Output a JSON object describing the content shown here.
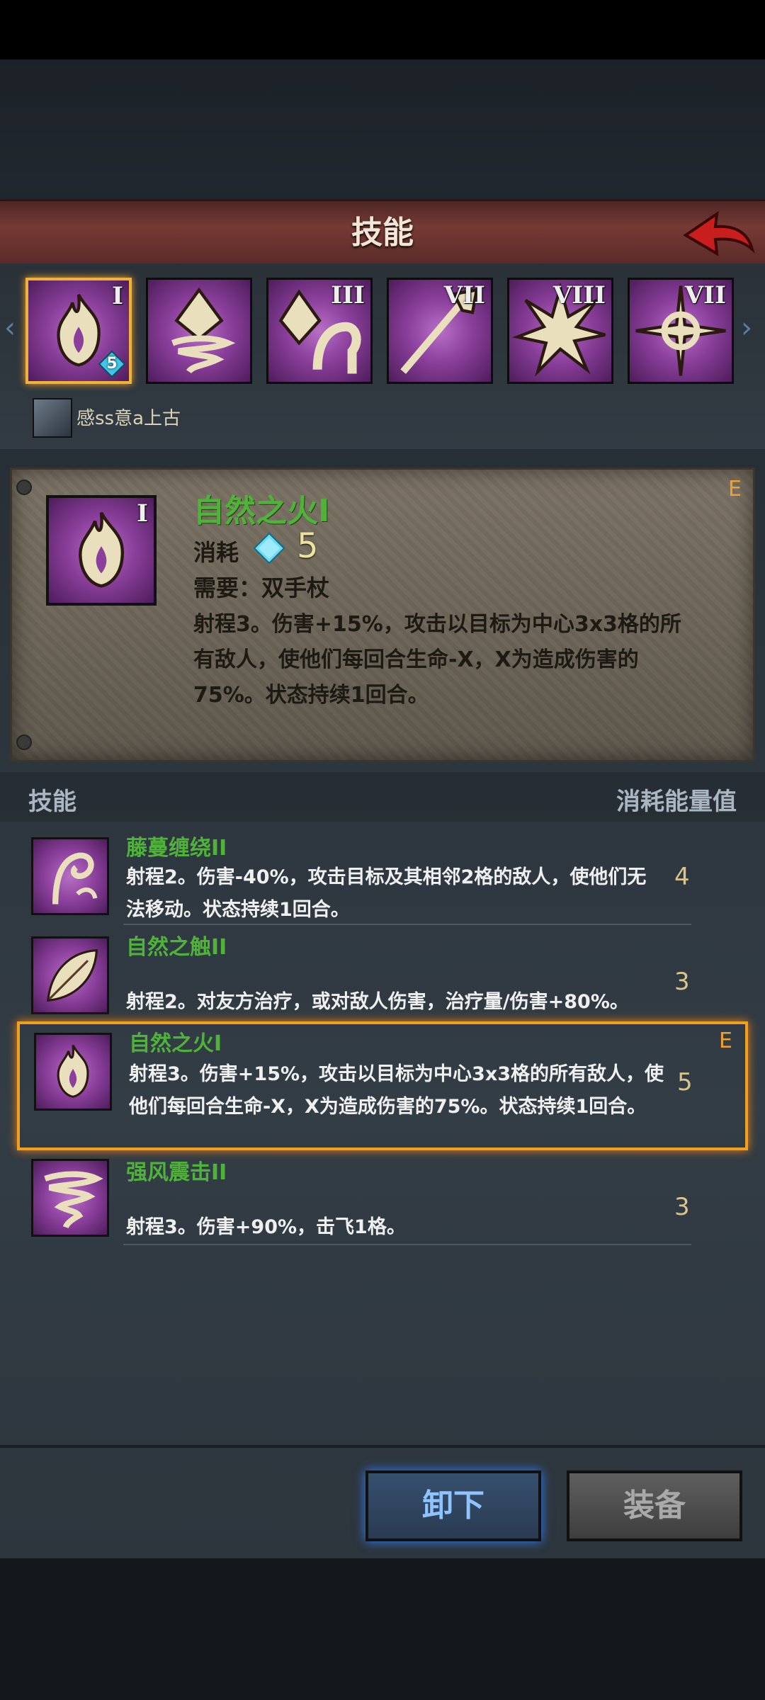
{
  "header": {
    "title": "技能"
  },
  "slots": [
    {
      "roman": "I",
      "icon": "flame-icon",
      "gem_value": "5",
      "selected": true
    },
    {
      "roman": "",
      "icon": "crystal-tornado-icon"
    },
    {
      "roman": "III",
      "icon": "crystal-vine-icon"
    },
    {
      "roman": "VII",
      "icon": "staff-icon"
    },
    {
      "roman": "VIII",
      "icon": "burst-icon"
    },
    {
      "roman": "VII",
      "icon": "holy-star-icon"
    }
  ],
  "user": {
    "name": "感ss意a上古"
  },
  "detail": {
    "name": "自然之火I",
    "roman": "I",
    "cost_label": "消耗",
    "cost_value": "5",
    "requirement": "需要：双手杖",
    "description": "射程3。伤害+15%，攻击以目标为中心3x3格的所有敌人，使他们每回合生命-X，X为造成伤害的75%。状态持续1回合。",
    "grade": "E"
  },
  "list_header": {
    "left": "技能",
    "right": "消耗能量值"
  },
  "skills": [
    {
      "name": "藤蔓缠绕II",
      "desc": "射程2。伤害-40%，攻击目标及其相邻2格的敌人，使他们无法移动。状态持续1回合。",
      "cost": "4",
      "icon": "vine-icon"
    },
    {
      "name": "自然之触II",
      "desc": "射程2。对友方治疗，或对敌人伤害，治疗量/伤害+80%。",
      "cost": "3",
      "icon": "leaf-icon"
    },
    {
      "name": "自然之火I",
      "desc": "射程3。伤害+15%，攻击以目标为中心3x3格的所有敌人，使他们每回合生命-X，X为造成伤害的75%。状态持续1回合。",
      "cost": "5",
      "icon": "flame-icon",
      "grade": "E",
      "selected": true
    },
    {
      "name": "强风震击II",
      "desc": "射程3。伤害+90%，击飞1格。",
      "cost": "3",
      "icon": "tornado-icon"
    }
  ],
  "buttons": {
    "unequip": "卸下",
    "equip": "装备"
  },
  "colors": {
    "accent_green": "#4fb33a",
    "selection_orange": "#f0a020",
    "slot_purple": "#8a3f9b"
  }
}
